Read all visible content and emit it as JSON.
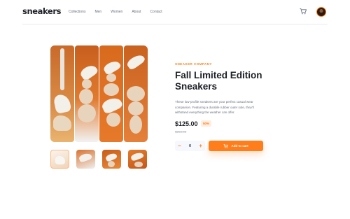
{
  "header": {
    "logo": "sneakers",
    "nav": [
      "Collections",
      "Men",
      "Women",
      "About",
      "Contact"
    ],
    "cart_icon": "cart-icon",
    "avatar": "user-avatar"
  },
  "colors": {
    "accent": "#ff7d1a",
    "accent_pale": "#ffede0",
    "text_dark": "#1d2025",
    "text_muted": "#69707d"
  },
  "product": {
    "company": "SNEAKER COMPANY",
    "title": "Fall Limited Edition Sneakers",
    "description": "These low-profile sneakers are your perfect casual wear companion. Featuring a durable rubber outer sole, they'll withstand everything the weather can offer.",
    "price": "$125.00",
    "discount": "50%",
    "original_price": "$250.00"
  },
  "quantity": {
    "minus": "−",
    "value": "0",
    "plus": "+"
  },
  "cta": {
    "label": "Add to cart",
    "icon": "cart-icon"
  },
  "gallery": {
    "thumbnails": 4,
    "active_thumbnail": 1
  }
}
